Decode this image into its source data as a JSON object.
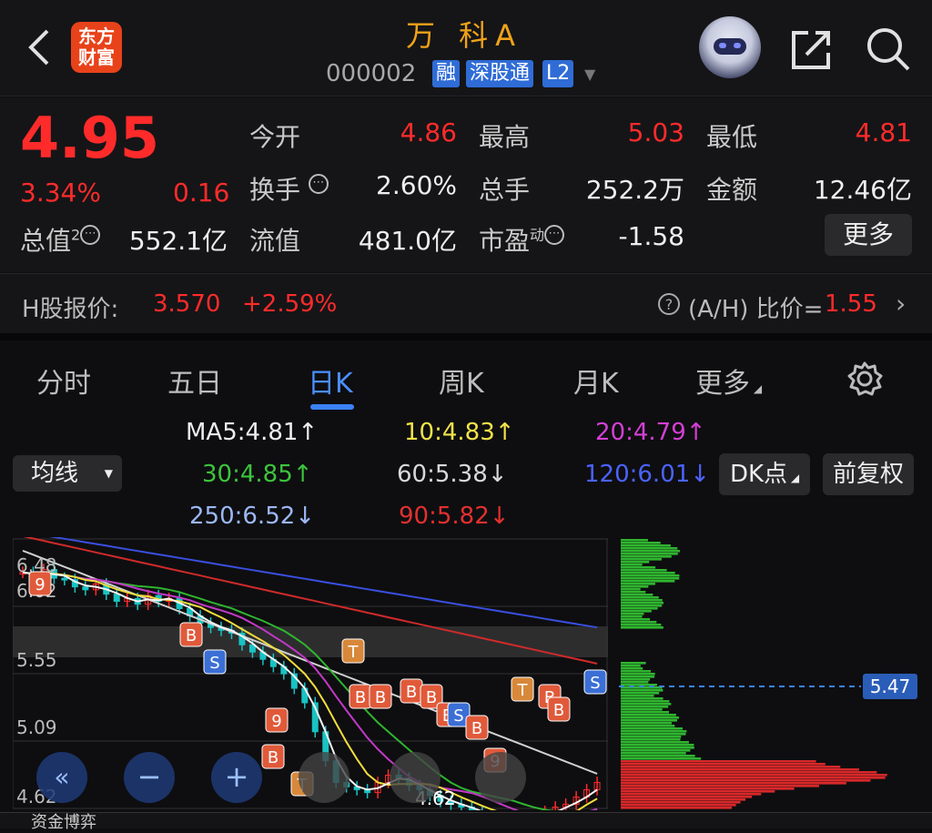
{
  "header": {
    "title": "万 科A",
    "code": "000002",
    "tags": [
      "融",
      "深股通",
      "L2"
    ],
    "logo_text": "东方财富"
  },
  "quote": {
    "price": "4.95",
    "change_pct": "3.34%",
    "change": "0.16",
    "open_label": "今开",
    "open": "4.86",
    "high_label": "最高",
    "high": "5.03",
    "low_label": "最低",
    "low": "4.81",
    "turnover_label": "换手",
    "turnover": "2.60%",
    "volume_label": "总手",
    "volume": "252.2万",
    "amount_label": "金额",
    "amount": "12.46亿",
    "mktcap_label": "总值",
    "mktcap_sup": "2",
    "mktcap": "552.1亿",
    "float_label": "流值",
    "float": "481.0亿",
    "pe_label": "市盈",
    "pe_sup": "动",
    "pe": "-1.58",
    "more_label": "更多"
  },
  "hshare": {
    "label": "H股报价:",
    "price": "3.570",
    "change": "+2.59%",
    "ratio_label": "(A/H) 比价=",
    "ratio": "1.55"
  },
  "tabs": [
    "分时",
    "五日",
    "日K",
    "周K",
    "月K",
    "更多"
  ],
  "ma": {
    "ma5": "MA5:4.81↑",
    "ma10": "10:4.83↑",
    "ma20": "20:4.79↑",
    "ma30": "30:4.85↑",
    "ma60": "60:5.38↓",
    "ma120": "120:6.01↓",
    "ma250": "250:6.52↓",
    "ma90": "90:5.82↓"
  },
  "controls": {
    "avg_select": "均线",
    "dk_button": "DK点",
    "adjust_button": "前复权"
  },
  "chart_data": {
    "type": "candlestick",
    "y_ticks": [
      "6.48",
      "6.02",
      "5.55",
      "5.09",
      "4.62"
    ],
    "low_marker": "4.62",
    "price_line": "5.47",
    "closes": [
      6.4,
      6.38,
      6.42,
      6.36,
      6.35,
      6.3,
      6.28,
      6.32,
      6.25,
      6.2,
      6.22,
      6.18,
      6.24,
      6.2,
      6.22,
      6.15,
      6.1,
      6.05,
      6.02,
      6.0,
      5.98,
      5.9,
      5.85,
      5.8,
      5.75,
      5.7,
      5.6,
      5.5,
      5.3,
      5.1,
      4.95,
      4.92,
      4.9,
      4.88,
      4.95,
      5.0,
      4.98,
      4.93,
      4.9,
      4.86,
      4.82,
      4.8,
      4.78,
      4.75,
      4.72,
      4.7,
      4.68,
      4.65,
      4.62,
      4.7,
      4.75,
      4.78,
      4.8,
      4.85,
      4.9,
      4.95
    ]
  },
  "signals": [
    "B",
    "S",
    "T",
    "9"
  ],
  "bottom": {
    "label": "资金博弈"
  }
}
